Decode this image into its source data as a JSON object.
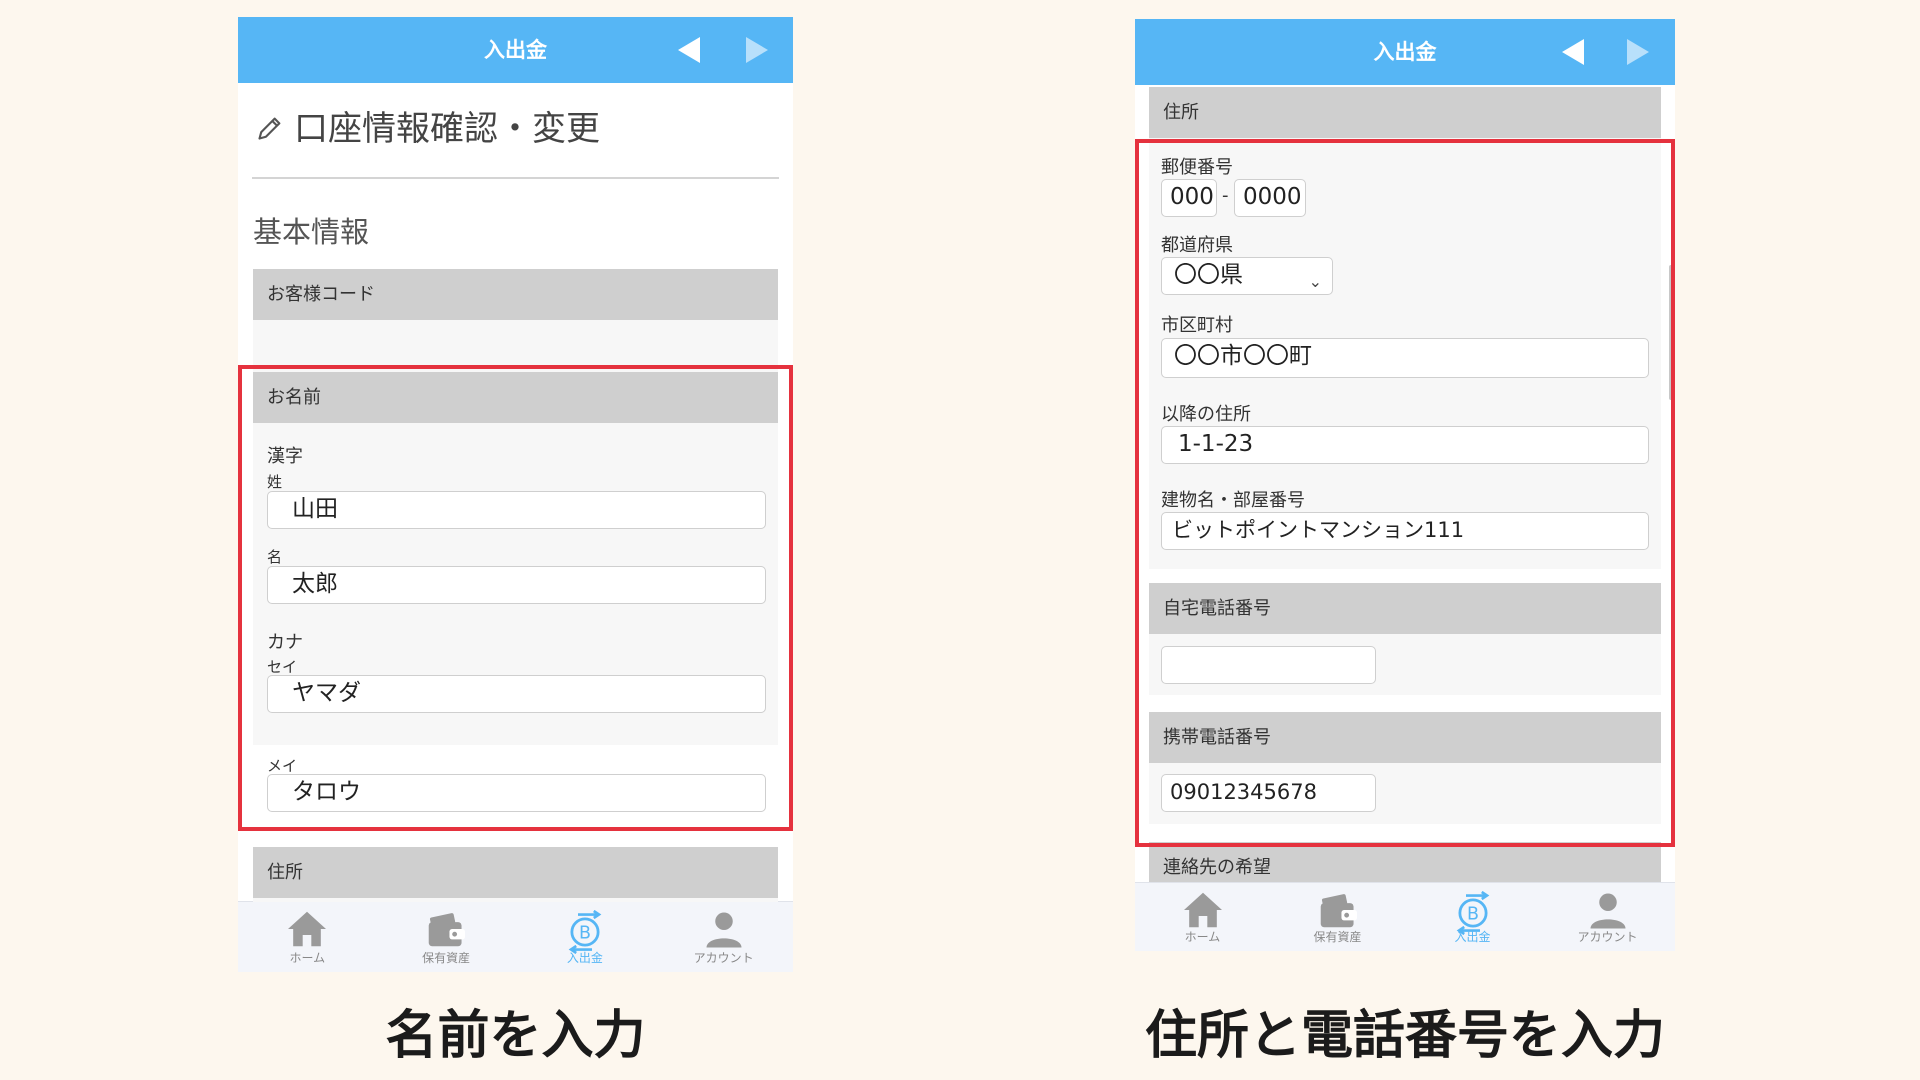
{
  "header": {
    "title": "入出金"
  },
  "left": {
    "page_title": "口座情報確認・変更",
    "section_heading": "基本情報",
    "customer_code_label": "お客様コード",
    "name": {
      "label": "お名前",
      "kanji_label": "漢字",
      "sei_label": "姓",
      "sei_value": "山田",
      "mei_label": "名",
      "mei_value": "太郎",
      "kana_label": "カナ",
      "sei_kana_label": "セイ",
      "sei_kana_value": "ヤマダ",
      "mei_kana_label": "メイ",
      "mei_kana_value": "タロウ"
    },
    "address_label": "住所"
  },
  "right": {
    "address_label": "住所",
    "postal_label": "郵便番号",
    "postal_1": "000",
    "postal_sep": "-",
    "postal_2": "0000",
    "prefecture_label": "都道府県",
    "prefecture_value": "〇〇県",
    "city_label": "市区町村",
    "city_value": "〇〇市〇〇町",
    "street_label": "以降の住所",
    "street_value": "1-1-23",
    "building_label": "建物名・部屋番号",
    "building_value": "ビットポイントマンション111",
    "home_phone_label": "自宅電話番号",
    "home_phone_value": "",
    "mobile_phone_label": "携帯電話番号",
    "mobile_phone_value": "09012345678",
    "contact_pref_label": "連絡先の希望"
  },
  "nav": {
    "items": [
      {
        "label": "ホーム",
        "icon": "home-icon"
      },
      {
        "label": "保有資産",
        "icon": "wallet-icon"
      },
      {
        "label": "入出金",
        "icon": "bitcoin-transfer-icon",
        "active": true
      },
      {
        "label": "アカウント",
        "icon": "user-icon"
      }
    ]
  },
  "captions": {
    "left": "名前を入力",
    "right": "住所と電話番号を入力"
  },
  "colors": {
    "header_blue": "#56b6f5",
    "highlight_red": "#e5323e",
    "page_bg": "#fdf7ee"
  }
}
